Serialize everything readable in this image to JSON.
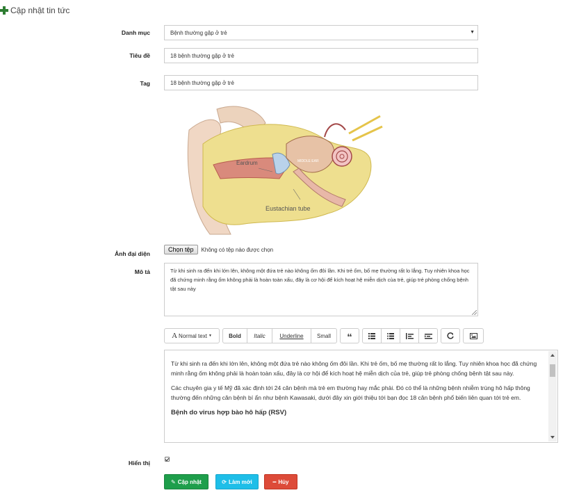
{
  "header": {
    "title": "Cập nhật tin tức"
  },
  "form": {
    "category": {
      "label": "Danh mục",
      "value": "Bệnh thường gặp ở trẻ"
    },
    "title": {
      "label": "Tiêu đề",
      "value": "18 bệnh thường gặp ở trẻ"
    },
    "tag": {
      "label": "Tag",
      "value": "18 bệnh thường gặp ở trẻ"
    },
    "image": {
      "label": "Ảnh đại diện",
      "choose_label": "Chọn tệp",
      "status": "Không có tệp nào được chọn",
      "figure_labels": {
        "eardrum": "Eardrum",
        "middle_ear": "MIDDLE EAR",
        "tube": "Eustachian tube"
      }
    },
    "description": {
      "label": "Mô tả",
      "value": "Từ khi sinh ra đến khi lớn lên, không một đứa trẻ nào không ốm đôi lần. Khi trẻ ốm, bố mẹ thường rất lo lắng. Tuy nhiên khoa học đã chứng minh rằng ốm không phải là hoàn toàn xấu, đây là cơ hội để kích hoạt hệ miễn dịch của trẻ, giúp trẻ phòng chống bệnh tật sau này"
    },
    "editor": {
      "toolbar": {
        "normal_text": "Normal text",
        "bold": "Bold",
        "italic": "Italic",
        "underline": "Underline",
        "small": "Small",
        "quote": "“",
        "icons": [
          "quote-icon",
          "ordered-list-icon",
          "unordered-list-icon",
          "outdent-icon",
          "indent-icon",
          "link-icon",
          "image-icon"
        ]
      },
      "paragraph1": "Từ khi sinh ra đến khi lớn lên, không một đứa trẻ nào không ốm đôi lần. Khi trẻ ốm, bố mẹ thường rất lo lắng. Tuy nhiên khoa học đã chứng minh rằng ốm không phải là hoàn toàn xấu, đây là cơ hội để kích hoạt hệ miễn dịch của trẻ, giúp trẻ phòng chống bệnh tật sau này.",
      "paragraph2": "Các chuyên gia y tế Mỹ đã xác định tới 24 căn bệnh mà trẻ em thường hay mắc phải. Đó có thể là những bệnh nhiễm trùng hô hấp thông thường đến những căn bệnh bí ẩn như bệnh Kawasaki, dưới đây xin giới thiệu tới bạn đọc 18 căn bệnh phổ biến liên quan tới trẻ em.",
      "heading": "Bệnh do virus hợp bào hô hấp (RSV)"
    },
    "visible": {
      "label": "Hiển thị",
      "checked": true
    }
  },
  "actions": {
    "update": "Cập nhật",
    "refresh": "Làm mới",
    "cancel": "Hủy"
  },
  "colors": {
    "update": "#1e9e4b",
    "refresh": "#1ebee8",
    "cancel": "#dd4b39",
    "plus": "#2e7d32"
  }
}
